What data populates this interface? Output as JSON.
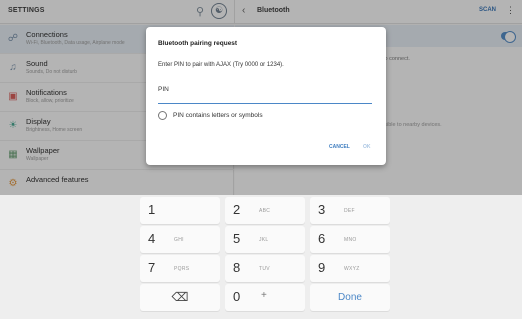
{
  "header": {
    "title": "SETTINGS",
    "right_title": "Bluetooth",
    "scan_label": "SCAN"
  },
  "menu": [
    {
      "label": "Connections",
      "sub": "Wi-Fi, Bluetooth, Data usage, Airplane mode",
      "icon": "connections-icon",
      "active": true
    },
    {
      "label": "Sound",
      "sub": "Sounds, Do not disturb",
      "icon": "sound-icon",
      "active": false
    },
    {
      "label": "Notifications",
      "sub": "Block, allow, prioritize",
      "icon": "notifications-icon",
      "active": false
    },
    {
      "label": "Display",
      "sub": "Brightness, Home screen",
      "icon": "display-icon",
      "active": false
    },
    {
      "label": "Wallpaper",
      "sub": "Wallpaper",
      "icon": "wallpaper-icon",
      "active": false
    },
    {
      "label": "Advanced features",
      "sub": "",
      "icon": "advanced-features-icon",
      "active": false
    }
  ],
  "right_pane": {
    "text1": "to connect.",
    "text2": "isible to nearby devices.",
    "toggle_on": true
  },
  "dialog": {
    "title": "Bluetooth pairing request",
    "message": "Enter PIN to pair with AJAX (Try 0000 or 1234).",
    "input_value": "PIN",
    "checkbox_label": "PIN contains letters or symbols",
    "checkbox_checked": false,
    "cancel_label": "CANCEL",
    "ok_label": "OK"
  },
  "keyboard": {
    "rows": [
      [
        {
          "num": "1",
          "letters": ""
        },
        {
          "num": "2",
          "letters": "ABC"
        },
        {
          "num": "3",
          "letters": "DEF"
        }
      ],
      [
        {
          "num": "4",
          "letters": "GHI"
        },
        {
          "num": "5",
          "letters": "JKL"
        },
        {
          "num": "6",
          "letters": "MNO"
        }
      ],
      [
        {
          "num": "7",
          "letters": "PQRS"
        },
        {
          "num": "8",
          "letters": "TUV"
        },
        {
          "num": "9",
          "letters": "WXYZ"
        }
      ]
    ],
    "backspace": "⌫",
    "zero": "0",
    "plus": "+",
    "done_label": "Done"
  },
  "colors": {
    "accent": "#4b87c7",
    "active_bg": "#e8f0f7",
    "keyboard_bg": "#eeeeee"
  }
}
